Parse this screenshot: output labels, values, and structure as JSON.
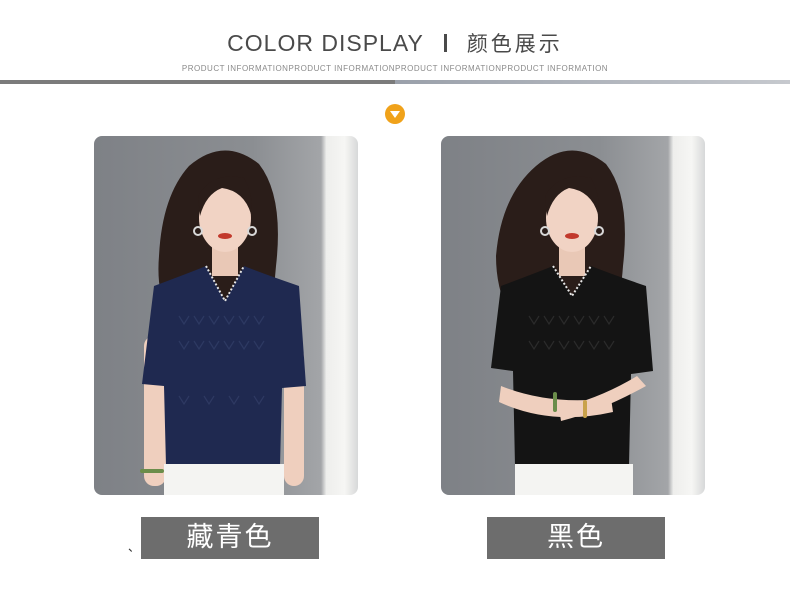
{
  "header": {
    "title_en": "COLOR DISPLAY",
    "title_cn": "颜色展示",
    "subtitle": "PRODUCT INFORMATIONPRODUCT INFORMATIONPRODUCT INFORMATIONPRODUCT INFORMATION"
  },
  "arrow_icon": "chevron-down-icon",
  "colors": {
    "accent": "#f0a21a",
    "navy_top": "#1f2950",
    "black_top": "#141414",
    "label_bg": "#6d6d6d"
  },
  "variants": [
    {
      "tick": "、",
      "label": "藏青色"
    },
    {
      "label": "黑色"
    }
  ]
}
